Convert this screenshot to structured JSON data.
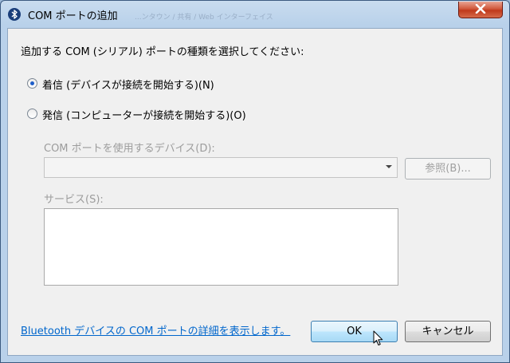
{
  "window": {
    "title": "COM ポートの追加",
    "background_title_fragment": "...ンタウン / 共有 / Web インターフェイス"
  },
  "instruction": "追加する COM (シリアル) ポートの種類を選択してください:",
  "options": [
    {
      "label": "着信 (デバイスが接続を開始する)(N)",
      "selected": true
    },
    {
      "label": "発信 (コンピューターが接続を開始する)(O)",
      "selected": false
    }
  ],
  "device_field": {
    "label": "COM ポートを使用するデバイス(D):",
    "value": "",
    "browse_label": "参照(B)...",
    "enabled": false
  },
  "service_field": {
    "label": "サービス(S):",
    "items": [],
    "enabled": false
  },
  "help_link": "Bluetooth デバイスの COM ポートの詳細を表示します。",
  "buttons": {
    "ok": "OK",
    "cancel": "キャンセル"
  },
  "icons": {
    "title_icon": "bluetooth-icon",
    "close": "close-icon",
    "dropdown": "chevron-down-icon",
    "pointer": "mouse-cursor-icon"
  },
  "colors": {
    "title_bar": "#b9d1ea",
    "close_button": "#c9482a",
    "link": "#0066cc",
    "disabled_text": "#9c9c9c"
  }
}
